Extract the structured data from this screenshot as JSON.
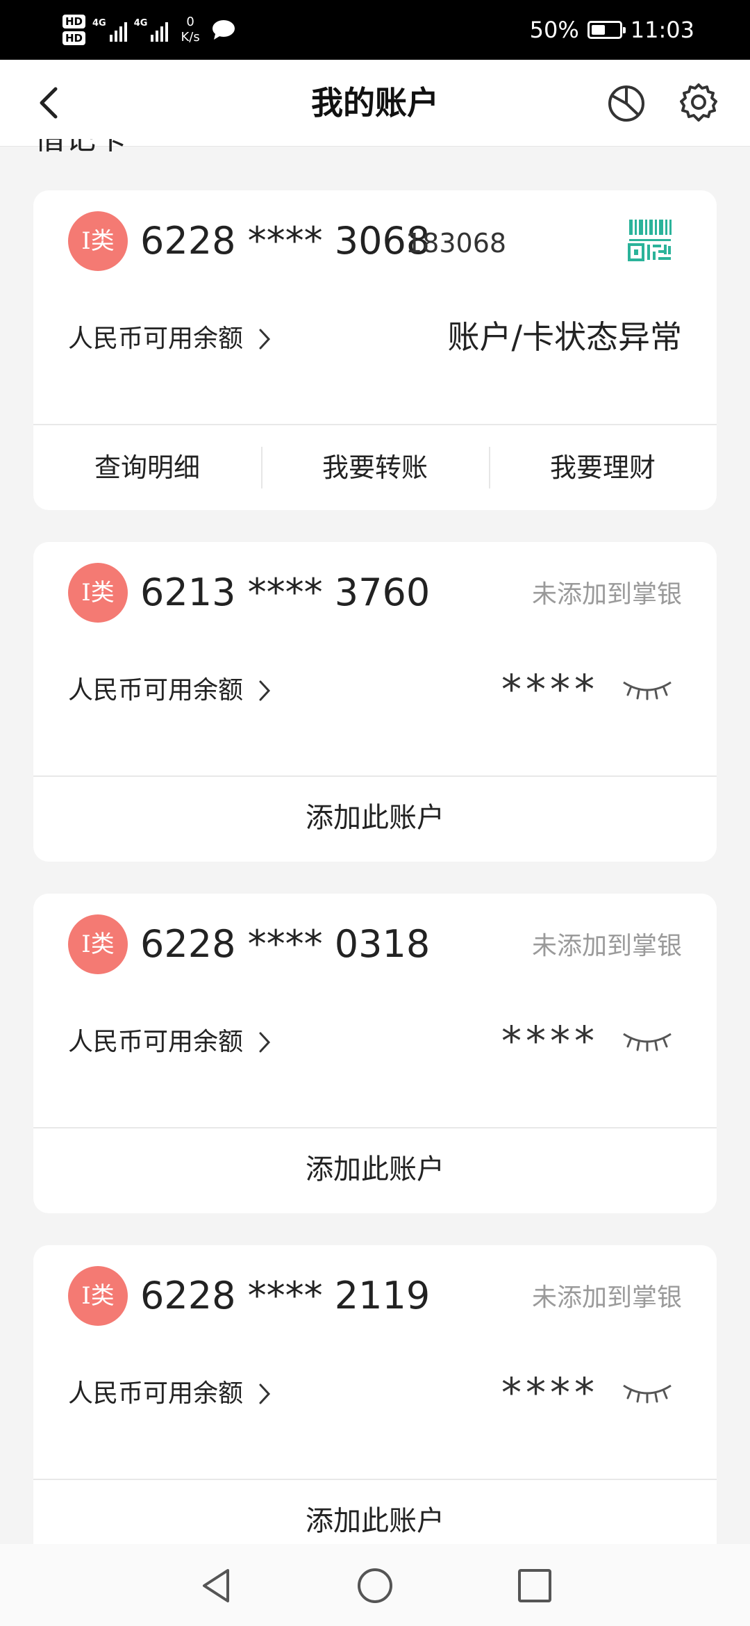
{
  "status_bar": {
    "network_1": "4G",
    "network_2": "4G",
    "speed_value": "0",
    "speed_unit": "K/s",
    "battery": "50%",
    "battery_level": 0.5,
    "time": "11:03"
  },
  "header": {
    "title": "我的账户"
  },
  "partial_heading": "借记卡",
  "cards": [
    {
      "badge": "I类",
      "number": "6228 **** 3068",
      "code": "183068",
      "balance_label": "人民币可用余额",
      "balance_value": "账户/卡状态异常",
      "actions": [
        "查询明细",
        "我要转账",
        "我要理财"
      ]
    },
    {
      "badge": "I类",
      "number": "6213 **** 3760",
      "status": "未添加到掌银",
      "balance_label": "人民币可用余额",
      "masked": "****",
      "add_label": "添加此账户"
    },
    {
      "badge": "I类",
      "number": "6228 **** 0318",
      "status": "未添加到掌银",
      "balance_label": "人民币可用余额",
      "masked": "****",
      "add_label": "添加此账户"
    },
    {
      "badge": "I类",
      "number": "6228 **** 2119",
      "status": "未添加到掌银",
      "balance_label": "人民币可用余额",
      "masked": "****",
      "add_label": "添加此账户"
    }
  ],
  "colors": {
    "badge": "#f47a73",
    "qr_accent": "#2bb39a",
    "background": "#f4f4f4"
  },
  "icons": [
    "back-icon",
    "pie-chart-icon",
    "gear-icon",
    "qr-code-icon",
    "eye-closed-icon",
    "chevron-right-icon",
    "nav-back-icon",
    "nav-home-icon",
    "nav-recents-icon"
  ]
}
